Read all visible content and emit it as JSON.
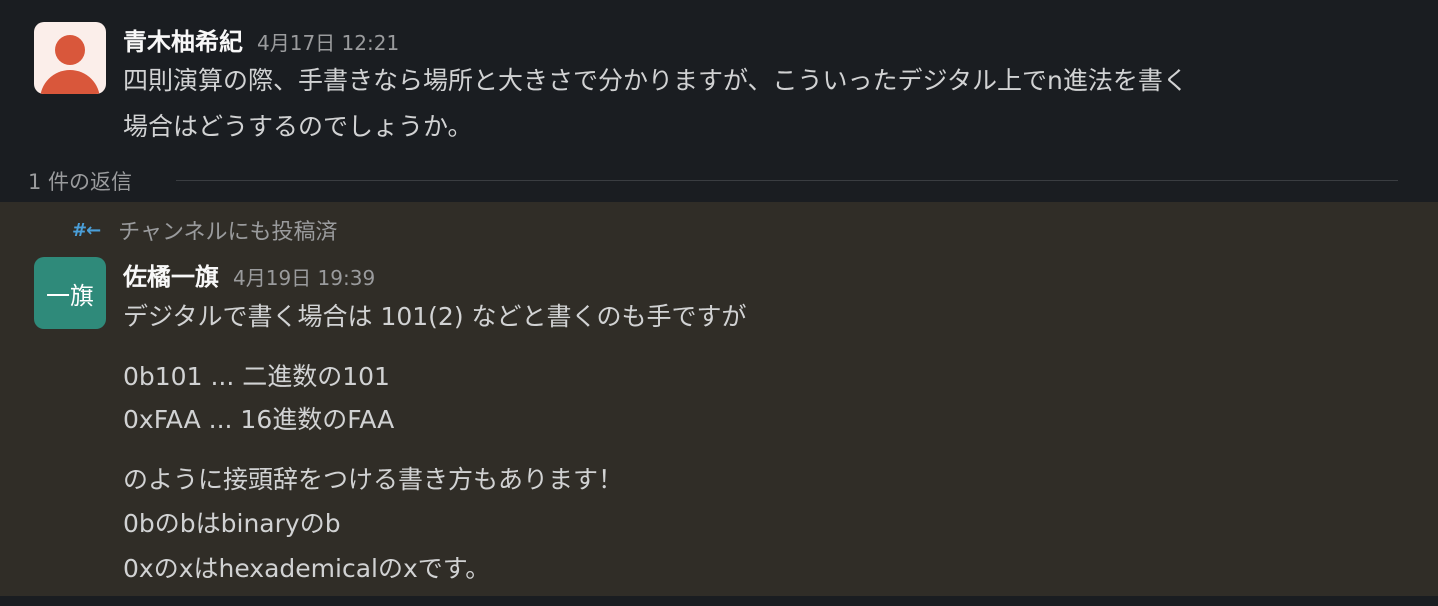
{
  "message1": {
    "author": "青木柚希紀",
    "timestamp": "4月17日 12:21",
    "lines": [
      "四則演算の際、手書きなら場所と大きさで分かりますが、こういったデジタル上でn進法を書く",
      "場合はどうするのでしょうか。"
    ]
  },
  "thread": {
    "replies_label": "1 件の返信"
  },
  "message2": {
    "posted_note": "チャンネルにも投稿済",
    "posted_icon": "#←",
    "avatar_text": "一旗",
    "author": "佐橘一旗",
    "timestamp": "4月19日 19:39",
    "lines": [
      "デジタルで書く場合は 101(2) などと書くのも手ですが",
      "0b101 ... 二進数の101",
      "0xFAA ... 16進数のFAA",
      "のように接頭辞をつける書き方もあります！",
      "0bのbはbinaryのb",
      "0xのxはhexademicalのxです。"
    ]
  }
}
